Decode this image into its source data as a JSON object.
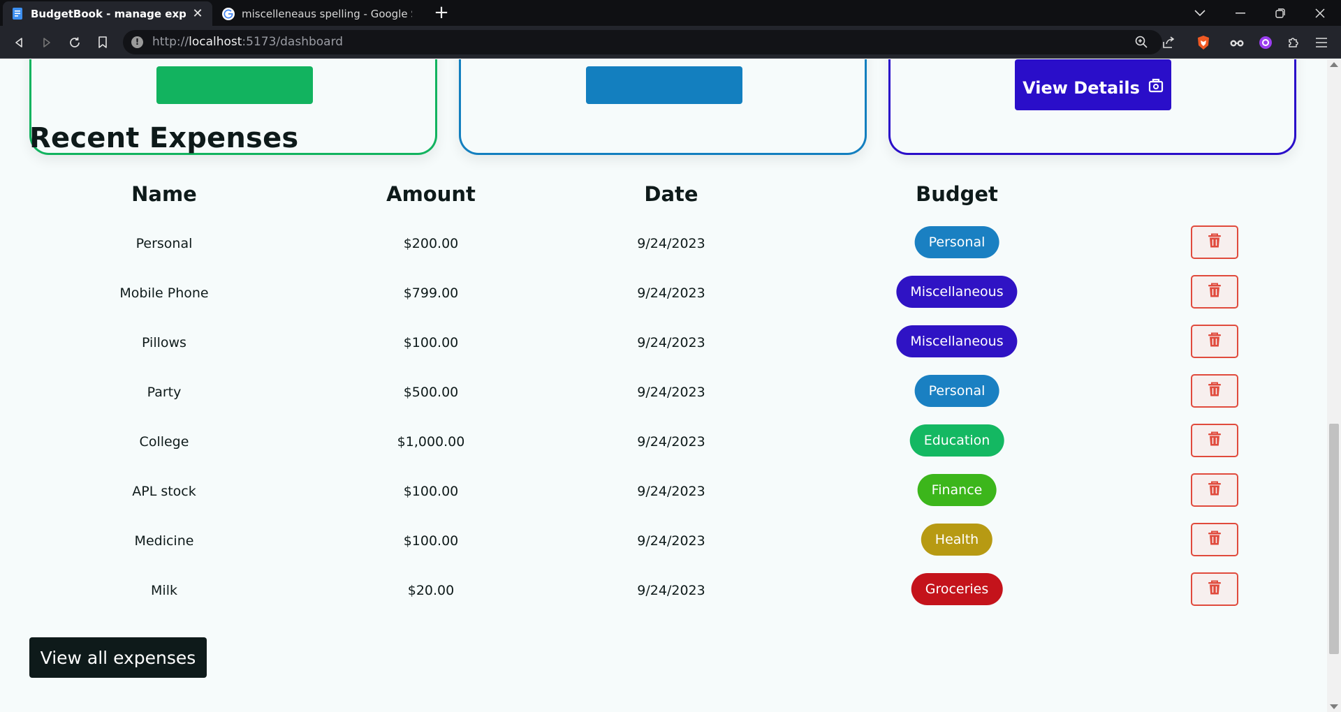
{
  "browser": {
    "tabs": [
      {
        "title": "BudgetBook - manage expenses",
        "active": true,
        "favicon": "document-icon"
      },
      {
        "title": "miscelleneaus spelling - Google Search",
        "active": false,
        "favicon": "google-icon"
      }
    ],
    "url_scheme": "http://",
    "url_host": "localhost",
    "url_path": ":5173/dashboard"
  },
  "cards": [
    {
      "color": "#12b35f",
      "button_label": "",
      "button_color": "#12b35f"
    },
    {
      "color": "#137fbf",
      "button_label": "",
      "button_color": "#137fbf"
    },
    {
      "color": "#2a0ec9",
      "button_label": "View Details",
      "button_color": "#2a0ec9"
    }
  ],
  "recent_expenses": {
    "title": "Recent Expenses",
    "columns": [
      "Name",
      "Amount",
      "Date",
      "Budget"
    ],
    "rows": [
      {
        "name": "Personal",
        "amount": "$200.00",
        "date": "9/24/2023",
        "budget": "Personal",
        "budget_color": "#1a80c2"
      },
      {
        "name": "Mobile Phone",
        "amount": "$799.00",
        "date": "9/24/2023",
        "budget": "Miscellaneous",
        "budget_color": "#2f13c4"
      },
      {
        "name": "Pillows",
        "amount": "$100.00",
        "date": "9/24/2023",
        "budget": "Miscellaneous",
        "budget_color": "#2f13c4"
      },
      {
        "name": "Party",
        "amount": "$500.00",
        "date": "9/24/2023",
        "budget": "Personal",
        "budget_color": "#1a80c2"
      },
      {
        "name": "College",
        "amount": "$1,000.00",
        "date": "9/24/2023",
        "budget": "Education",
        "budget_color": "#14b862"
      },
      {
        "name": "APL stock",
        "amount": "$100.00",
        "date": "9/24/2023",
        "budget": "Finance",
        "budget_color": "#3cb61b"
      },
      {
        "name": "Medicine",
        "amount": "$100.00",
        "date": "9/24/2023",
        "budget": "Health",
        "budget_color": "#b79a13"
      },
      {
        "name": "Milk",
        "amount": "$20.00",
        "date": "9/24/2023",
        "budget": "Groceries",
        "budget_color": "#c4131b"
      }
    ],
    "view_all_label": "View all expenses"
  }
}
